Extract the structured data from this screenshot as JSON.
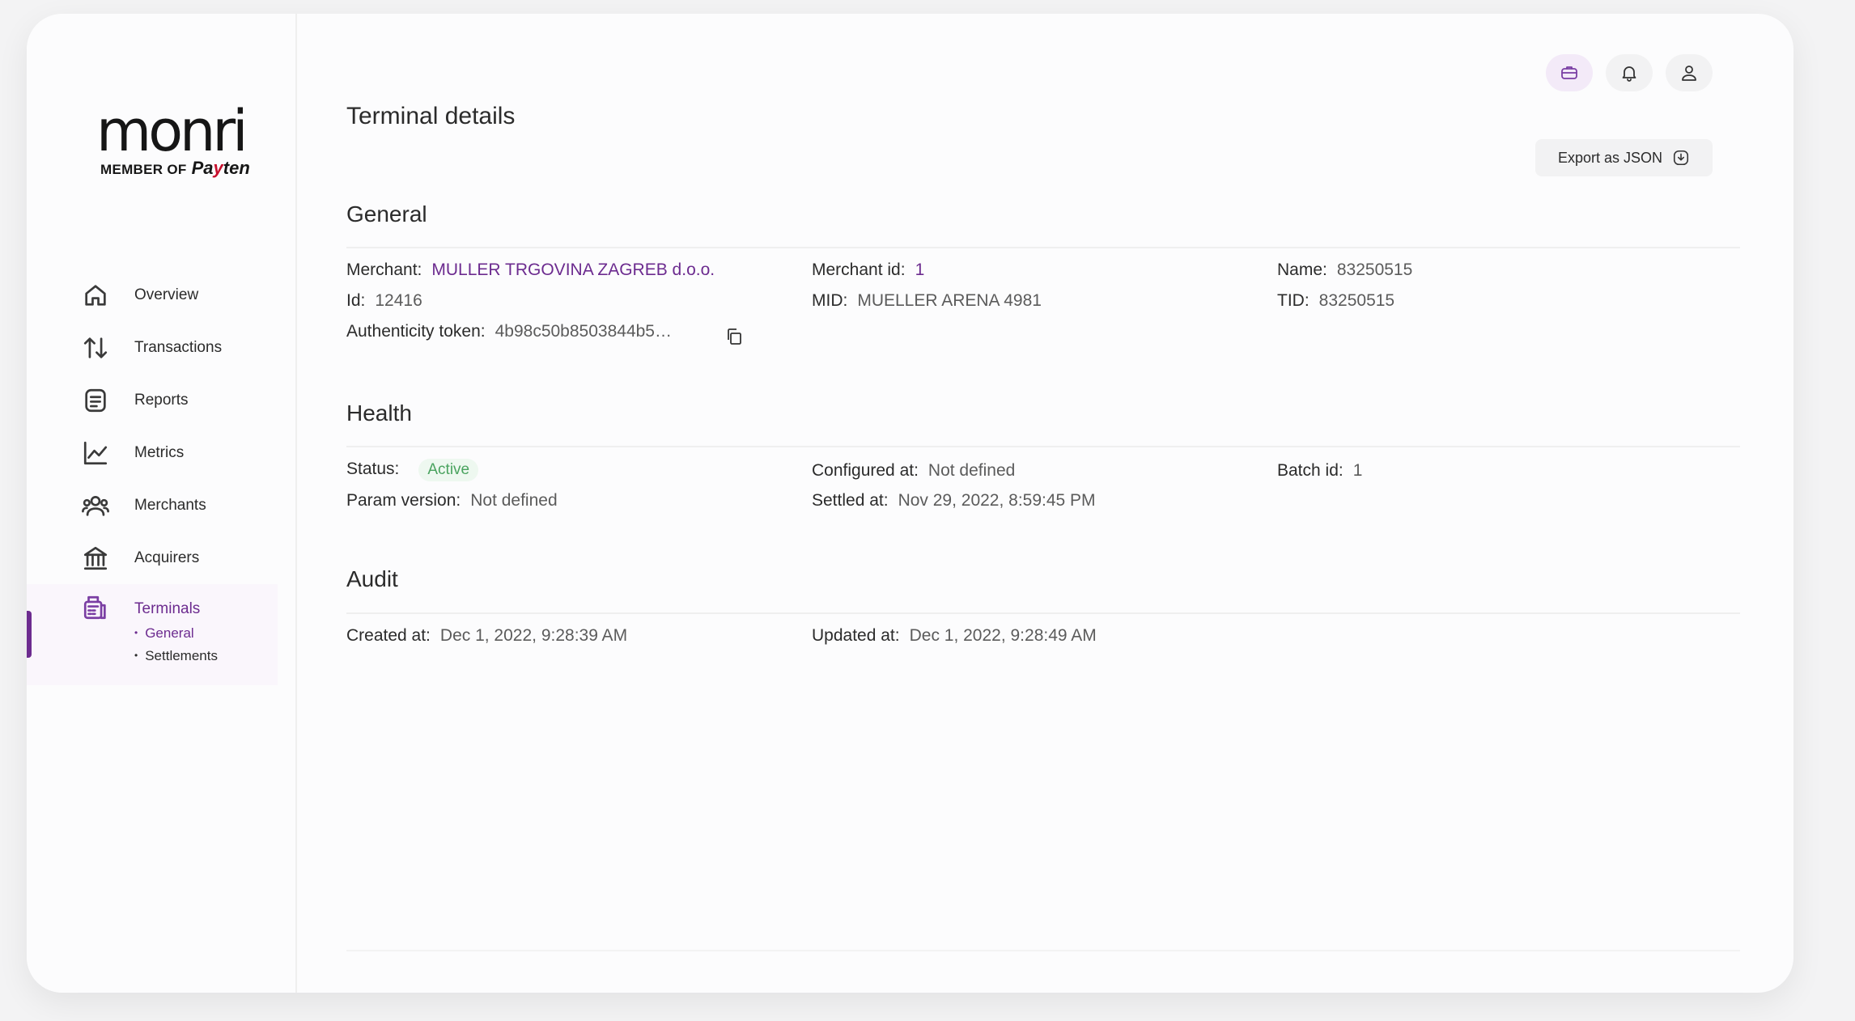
{
  "logo": {
    "word": "monri",
    "member_of": "MEMBER OF",
    "payten_pa": "Pa",
    "payten_y": "y",
    "payten_ten": "ten"
  },
  "nav": {
    "overview": "Overview",
    "transactions": "Transactions",
    "reports": "Reports",
    "metrics": "Metrics",
    "merchants": "Merchants",
    "acquirers": "Acquirers",
    "terminals": "Terminals",
    "sub_general": "General",
    "sub_settlements": "Settlements"
  },
  "header": {
    "title": "Terminal details",
    "export_label": "Export as JSON",
    "icons": [
      "briefcase-icon",
      "bell-icon",
      "user-icon"
    ]
  },
  "general": {
    "title": "General",
    "merchant_label": "Merchant:",
    "merchant_value": "MULLER TRGOVINA ZAGREB d.o.o.",
    "merchant_id_label": "Merchant id:",
    "merchant_id_value": "1",
    "name_label": "Name:",
    "name_value": "83250515",
    "id_label": "Id:",
    "id_value": "12416",
    "mid_label": "MID:",
    "mid_value": "MUELLER ARENA 4981",
    "tid_label": "TID:",
    "tid_value": "83250515",
    "token_label": "Authenticity token:",
    "token_value": "4b98c50b8503844b5…"
  },
  "health": {
    "title": "Health",
    "status_label": "Status:",
    "status_value": "Active",
    "configured_label": "Configured at:",
    "configured_value": "Not defined",
    "batch_label": "Batch id:",
    "batch_value": "1",
    "param_label": "Param version:",
    "param_value": "Not defined",
    "settled_label": "Settled at:",
    "settled_value": "Nov 29, 2022, 8:59:45 PM"
  },
  "audit": {
    "title": "Audit",
    "created_label": "Created at:",
    "created_value": "Dec 1, 2022, 9:28:39 AM",
    "updated_label": "Updated at:",
    "updated_value": "Dec 1, 2022, 9:28:49 AM"
  },
  "colors": {
    "accent": "#6c2b8f",
    "active_badge": "#4aa35f",
    "background": "#fcfcfd"
  }
}
